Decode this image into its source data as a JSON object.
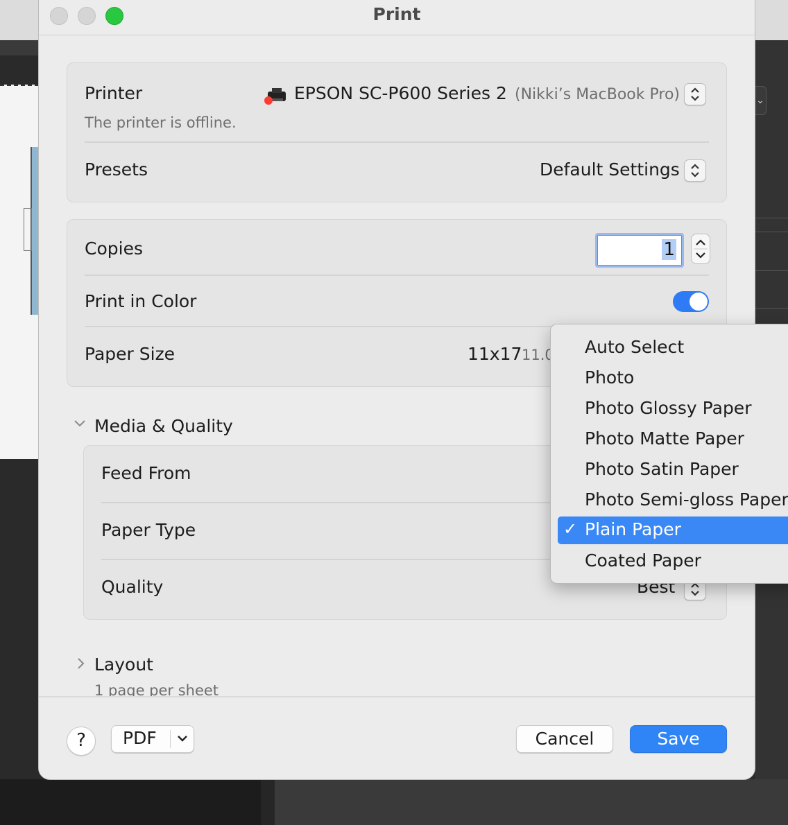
{
  "dialog": {
    "title": "Print"
  },
  "printer": {
    "label": "Printer",
    "name": "EPSON SC-P600 Series 2",
    "host": "(Nikki’s MacBook Pro)",
    "status": "The printer is offline.",
    "status_dot_color": "#ff3b30"
  },
  "presets": {
    "label": "Presets",
    "value": "Default Settings"
  },
  "copies": {
    "label": "Copies",
    "value": "1"
  },
  "color": {
    "label": "Print in Color",
    "enabled": true,
    "accent": "#2f7bf6"
  },
  "paper_size": {
    "label": "Paper Size",
    "value": "11x17",
    "detail": "11.0"
  },
  "media_quality": {
    "title": "Media & Quality",
    "feed_from_label": "Feed From",
    "paper_type_label": "Paper Type",
    "quality_label": "Quality",
    "quality_value": "Best"
  },
  "layout": {
    "title": "Layout",
    "summary": "1 page per sheet"
  },
  "footer": {
    "help": "?",
    "pdf": "PDF",
    "cancel": "Cancel",
    "save": "Save"
  },
  "paper_type_menu": {
    "items": [
      "Auto Select",
      "Photo",
      "Photo Glossy Paper",
      "Photo Matte Paper",
      "Photo Satin Paper",
      "Photo Semi-gloss Paper",
      "Plain Paper",
      "Coated Paper"
    ],
    "selected": "Plain Paper",
    "check": "✓"
  }
}
